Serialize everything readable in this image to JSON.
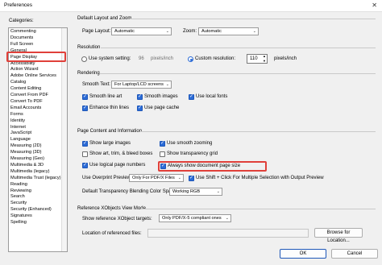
{
  "window": {
    "title": "Preferences",
    "close_icon": "close-icon"
  },
  "categories": {
    "label": "Categories:",
    "items": [
      "Commenting",
      "Documents",
      "Full Screen",
      "General",
      "Page Display",
      "Accessibility",
      "Action Wizard",
      "Adobe Online Services",
      "Catalog",
      "Content Editing",
      "Convert From PDF",
      "Convert To PDF",
      "Email Accounts",
      "Forms",
      "Identity",
      "Internet",
      "JavaScript",
      "Language",
      "Measuring (2D)",
      "Measuring (3D)",
      "Measuring (Geo)",
      "Multimedia & 3D",
      "Multimedia (legacy)",
      "Multimedia Trust (legacy)",
      "Reading",
      "Reviewing",
      "Search",
      "Security",
      "Security (Enhanced)",
      "Signatures",
      "Spelling"
    ],
    "selected": "Page Display"
  },
  "layout_zoom": {
    "section_title": "Default Layout and Zoom",
    "page_layout_label": "Page Layout:",
    "page_layout_value": "Automatic",
    "zoom_label": "Zoom:",
    "zoom_value": "Automatic"
  },
  "resolution": {
    "section_title": "Resolution",
    "system_setting_label": "Use system setting:",
    "system_value": "96",
    "system_units": "pixels/inch",
    "custom_label": "Custom resolution:",
    "custom_value": "110",
    "custom_units": "pixels/inch",
    "selected": "custom"
  },
  "rendering": {
    "section_title": "Rendering",
    "smooth_text_label": "Smooth Text:",
    "smooth_text_value": "For Laptop/LCD screens",
    "smooth_line_art": "Smooth line art",
    "smooth_images": "Smooth images",
    "use_local_fonts": "Use local fonts",
    "enhance_thin_lines": "Enhance thin lines",
    "use_page_cache": "Use page cache"
  },
  "page_content": {
    "section_title": "Page Content and Information",
    "show_large_images": "Show large images",
    "use_smooth_zooming": "Use smooth zooming",
    "show_art_trim_bleed": "Show art, trim, & bleed boxes",
    "show_transparency_grid": "Show transparency grid",
    "use_logical_page_numbers": "Use logical page numbers",
    "always_show_doc_size": "Always show document page size",
    "overprint_label": "Use Overprint Preview:",
    "overprint_value": "Only For PDF/X Files",
    "shift_click_label": "Use Shift + Click For Multiple Selection with Output Preview",
    "blending_label": "Default Transparency Blending Color Space:",
    "blending_value": "Working RGB"
  },
  "xobjects": {
    "section_title": "Reference XObjects View Mode",
    "show_targets_label": "Show reference XObject targets:",
    "show_targets_value": "Only PDF/X-5 compliant ones",
    "location_label": "Location of referenced files:",
    "browse_label": "Browse for Location..."
  },
  "footer": {
    "ok_label": "OK",
    "cancel_label": "Cancel"
  }
}
